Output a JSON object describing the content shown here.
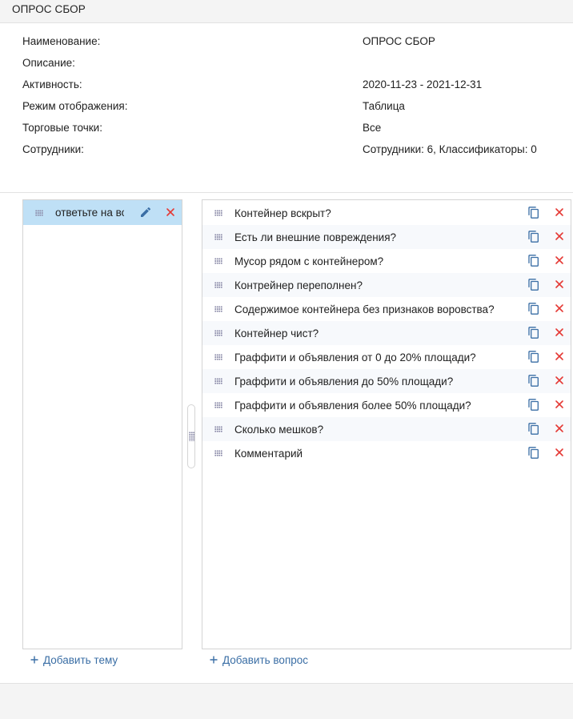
{
  "header": {
    "title": "ОПРОС СБОР"
  },
  "info": {
    "rows": [
      {
        "label": "Наименование:",
        "value": "ОПРОС СБОР"
      },
      {
        "label": "Описание:",
        "value": ""
      },
      {
        "label": "Активность:",
        "value": "2020-11-23 - 2021-12-31"
      },
      {
        "label": "Режим отображения:",
        "value": "Таблица"
      },
      {
        "label": "Торговые точки:",
        "value": "Все"
      },
      {
        "label": "Сотрудники:",
        "value": "Сотрудники: 6, Классификаторы: 0"
      }
    ]
  },
  "topics": {
    "items": [
      {
        "label": "ответьте на вопросы"
      }
    ],
    "add_label": "Добавить тему"
  },
  "questions": {
    "items": [
      {
        "label": "Контейнер вскрыт?"
      },
      {
        "label": "Есть ли внешние повреждения?"
      },
      {
        "label": "Мусор рядом с контейнером?"
      },
      {
        "label": "Контрейнер переполнен?"
      },
      {
        "label": "Содержимое контейнера без признаков воровства?"
      },
      {
        "label": "Контейнер чист?"
      },
      {
        "label": "Граффити и объявления от 0 до 20% площади?"
      },
      {
        "label": "Граффити и объявления до 50% площади?"
      },
      {
        "label": "Граффити и объявления более 50% площади?"
      },
      {
        "label": "Сколько мешков?"
      },
      {
        "label": "Комментарий"
      }
    ],
    "add_label": "Добавить вопрос"
  },
  "icons": {
    "drag": "drag-handle-icon",
    "edit": "pencil-icon",
    "delete": "close-icon",
    "copy": "copy-icon",
    "add": "plus-icon"
  },
  "colors": {
    "accent_blue": "#3a6ea5",
    "delete_red": "#e53935",
    "selected_bg": "#bfe0f6",
    "header_bg": "#f4f4f4"
  }
}
